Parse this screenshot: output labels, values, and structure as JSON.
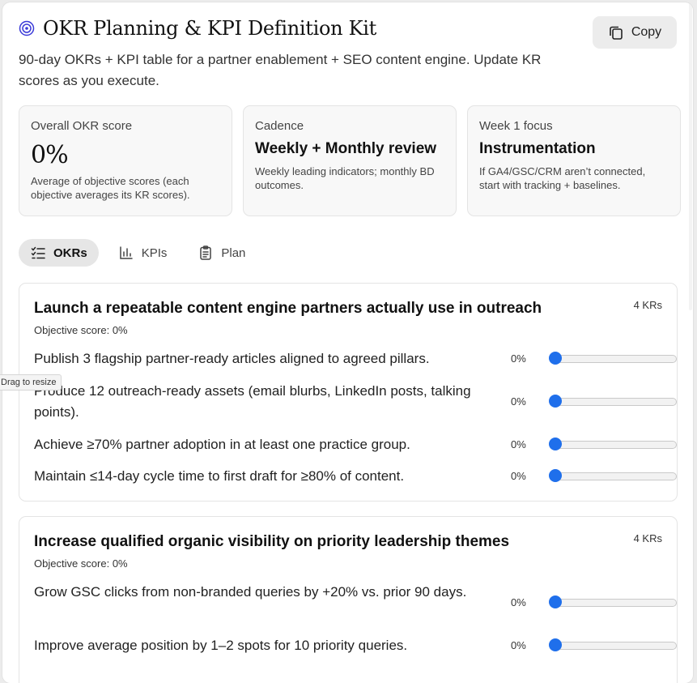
{
  "header": {
    "title": "OKR Planning & KPI Definition Kit",
    "subtitle": "90-day OKRs + KPI table for a partner enablement + SEO content engine. Update KR scores as you execute.",
    "copy_label": "Copy",
    "title_icon": "target-icon",
    "copy_icon": "copy-icon"
  },
  "cards": [
    {
      "label": "Overall OKR score",
      "value": "0%",
      "note": "Average of objective scores (each objective averages its KR scores)."
    },
    {
      "label": "Cadence",
      "value": "Weekly + Monthly review",
      "note": "Weekly leading indicators; monthly BD outcomes."
    },
    {
      "label": "Week 1 focus",
      "value": "Instrumentation",
      "note": "If GA4/GSC/CRM aren’t connected, start with tracking + baselines."
    }
  ],
  "tabs": [
    {
      "label": "OKRs",
      "icon": "checklist-icon",
      "active": true
    },
    {
      "label": "KPIs",
      "icon": "bar-chart-icon",
      "active": false
    },
    {
      "label": "Plan",
      "icon": "clipboard-icon",
      "active": false
    }
  ],
  "tooltip": "Drag to resize",
  "objectives": [
    {
      "title": "Launch a repeatable content engine partners actually use in outreach",
      "kr_count": "4 KRs",
      "score": "Objective score: 0%",
      "krs": [
        {
          "text": "Publish 3 flagship partner-ready articles aligned to agreed pillars.",
          "pct": "0%",
          "value": 0
        },
        {
          "text": "Produce 12 outreach-ready assets (email blurbs, LinkedIn posts, talking points).",
          "pct": "0%",
          "value": 0
        },
        {
          "text": "Achieve ≥70% partner adoption in at least one practice group.",
          "pct": "0%",
          "value": 0
        },
        {
          "text": "Maintain ≤14-day cycle time to first draft for ≥80% of content.",
          "pct": "0%",
          "value": 0
        }
      ]
    },
    {
      "title": "Increase qualified organic visibility on priority leadership themes",
      "kr_count": "4 KRs",
      "score": "Objective score: 0%",
      "krs": [
        {
          "text": "Grow GSC clicks from non-branded queries by +20% vs. prior 90 days.",
          "pct": "0%",
          "value": 0
        },
        {
          "text": "Improve average position by 1–2 spots for 10 priority queries.",
          "pct": "0%",
          "value": 0
        }
      ]
    }
  ],
  "colors": {
    "accent": "#1f6feb",
    "icon": "#3a3ad8"
  }
}
